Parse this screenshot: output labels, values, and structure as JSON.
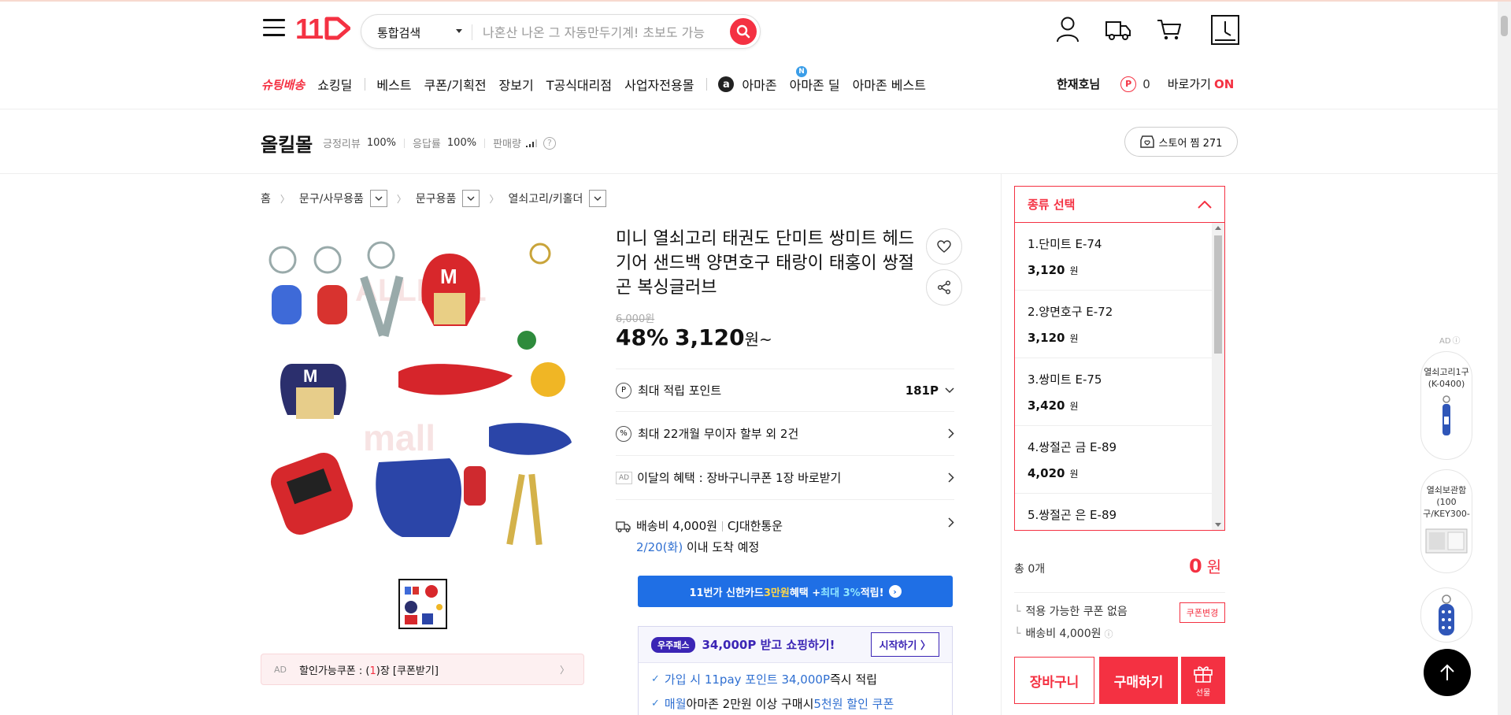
{
  "header": {
    "logo": "11",
    "search_category": "통합검색",
    "search_placeholder": "나혼산 나온 그 자동만두기계! 초보도 가능"
  },
  "nav": {
    "shooting": "슈팅배송",
    "items": [
      "쇼킹딜",
      "베스트",
      "쿠폰/기획전",
      "장보기",
      "T공식대리점",
      "사업자전용몰"
    ],
    "amazon_icon": "a",
    "amazon_items": [
      "아마존",
      "아마존 딜",
      "아마존 베스트"
    ],
    "new_badge": "N",
    "user_name": "한재호님",
    "point_icon": "P",
    "point_value": "0",
    "direct_label": "바로가기",
    "direct_on": "ON"
  },
  "store": {
    "name": "올킬몰",
    "review_label": "긍정리뷰",
    "review_value": "100%",
    "response_label": "응답률",
    "response_value": "100%",
    "sales_label": "판매량",
    "help": "?",
    "fav_label": "스토어 찜 271"
  },
  "breadcrumb": [
    "홈",
    "문구/사무용품",
    "문구용품",
    "열쇠고리/키홀더"
  ],
  "coupon_bar": {
    "ad": "AD",
    "text_prefix": "할인가능쿠폰 : (",
    "count": "1",
    "text_suffix": ")장 [쿠폰받기]"
  },
  "product": {
    "title": "미니 열쇠고리 태권도 단미트 쌍미트 헤드기어 샌드백 양면호구 태랑이 태홍이 쌍절곤 복싱글러브",
    "orig_price": "6,000원",
    "discount": "48%",
    "price": "3,120",
    "price_unit": "원~",
    "point_label": "최대 적립 포인트",
    "point_value": "181P",
    "install_label": "최대 22개월 무이자 할부 외 2건",
    "benefit_ad": "AD",
    "benefit_label": "이달의 혜택 : 장바구니쿠폰 1장 바로받기",
    "ship_fee": "배송비 4,000원",
    "ship_company": "CJ대한통운",
    "ship_date": "2/20(화)",
    "ship_suffix": " 이내 도착 예정",
    "card_banner": {
      "part1": "11번가 신한카드 ",
      "highlight1": "3만원",
      "part2": " 혜택 + ",
      "highlight2": "최대 3%",
      "part3": " 적립!"
    },
    "uju": {
      "badge": "우주패스",
      "title": "34,000P 받고 쇼핑하기!",
      "start": "시작하기 〉",
      "line1_a": "가입 시 11pay 포인트 34,000P",
      "line1_b": " 즉시 적립",
      "line2_a": "매월",
      "line2_b": " 아마존 2만원 이상 구매시 ",
      "line2_c": "5천원 할인 쿠폰"
    }
  },
  "options": {
    "header": "종류 선택",
    "items": [
      {
        "name": "1.단미트 E-74",
        "price": "3,120",
        "won": "원"
      },
      {
        "name": "2.양면호구 E-72",
        "price": "3,120",
        "won": "원"
      },
      {
        "name": "3.쌍미트 E-75",
        "price": "3,420",
        "won": "원"
      },
      {
        "name": "4.쌍절곤 금 E-89",
        "price": "4,020",
        "won": "원"
      },
      {
        "name": "5.쌍절곤 은 E-89",
        "price": "",
        "won": ""
      }
    ]
  },
  "order": {
    "total_label": "총 0개",
    "total_value": "0",
    "total_won": "원",
    "coupon_none": "적용 가능한 쿠폰 없음",
    "coupon_change": "쿠폰변경",
    "ship_fee": "배송비 4,000원",
    "cart": "장바구니",
    "buy": "구매하기",
    "gift": "선물"
  },
  "ad_rail": {
    "label": "AD",
    "cards": [
      "열쇠고리1구(K-0400)",
      "열쇠보관함(100구/KEY300-"
    ]
  },
  "colors": {
    "brand": "#f43142",
    "card_blue": "#1f6fe5",
    "uju_purple": "#3b25b5"
  }
}
